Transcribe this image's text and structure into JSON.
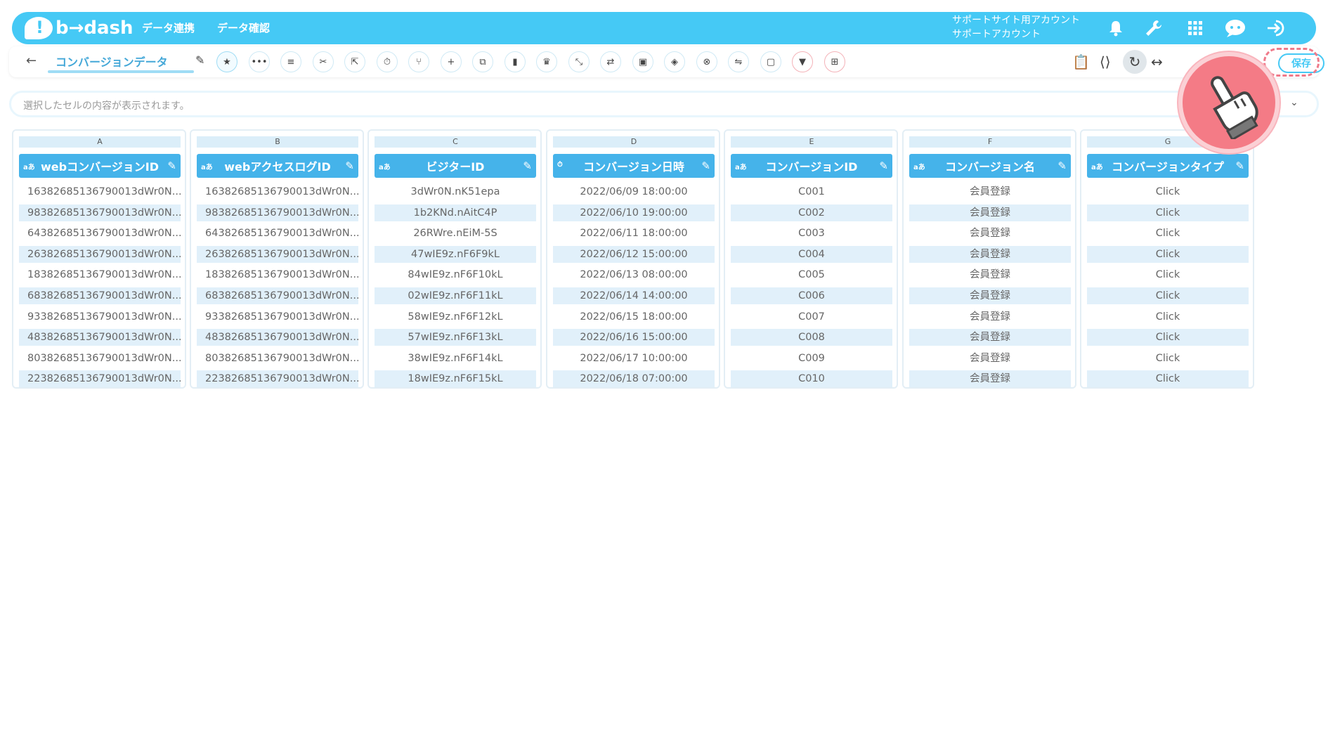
{
  "header": {
    "logo_text": "b→dash",
    "nav": [
      "データ連携",
      "データ確認"
    ],
    "account_line1": "サポートサイト用アカウント",
    "account_line2": "サポートアカウント",
    "icons": [
      "bell-icon",
      "wrench-icon",
      "apps-grid-icon",
      "chat-icon",
      "logout-icon"
    ]
  },
  "toolbar": {
    "back_icon": "←",
    "sheet_name": "コンバージョンデータ",
    "tool_icons": [
      "star-icon",
      "more-icon",
      "list-icon",
      "cut-icon",
      "expand-icon",
      "timer-icon",
      "merge-icon",
      "plus-icon",
      "copy-icon",
      "trash-icon",
      "crown-icon",
      "shrink-icon",
      "repeat-icon",
      "lock-icon",
      "stack-icon",
      "cancel-icon",
      "translate-icon",
      "frame-icon",
      "filter-icon",
      "grid-icon"
    ],
    "right_icons": [
      "clipboard-icon",
      "share-icon",
      "refresh-icon",
      "code-icon"
    ],
    "save_label": "保存"
  },
  "cellbar": {
    "placeholder": "選択したセルの内容が表示されます。"
  },
  "columns": [
    {
      "letter": "A",
      "type": "aあ",
      "header": "webコンバージョンID",
      "truncated": true,
      "rows": [
        "16382685136790013dWr0N...",
        "98382685136790013dWr0N...",
        "64382685136790013dWr0N...",
        "26382685136790013dWr0N...",
        "18382685136790013dWr0N...",
        "68382685136790013dWr0N...",
        "93382685136790013dWr0N...",
        "48382685136790013dWr0N...",
        "80382685136790013dWr0N...",
        "22382685136790013dWr0N..."
      ]
    },
    {
      "letter": "B",
      "type": "aあ",
      "header": "webアクセスログID",
      "truncated": true,
      "rows": [
        "16382685136790013dWr0N...",
        "98382685136790013dWr0N...",
        "64382685136790013dWr0N...",
        "26382685136790013dWr0N...",
        "18382685136790013dWr0N...",
        "68382685136790013dWr0N...",
        "93382685136790013dWr0N...",
        "48382685136790013dWr0N...",
        "80382685136790013dWr0N...",
        "22382685136790013dWr0N..."
      ]
    },
    {
      "letter": "C",
      "type": "aあ",
      "header": "ビジターID",
      "truncated": false,
      "rows": [
        "3dWr0N.nK51epa",
        "1b2KNd.nAitC4P",
        "26RWre.nEiM-5S",
        "47wIE9z.nF6F9kL",
        "84wIE9z.nF6F10kL",
        "02wIE9z.nF6F11kL",
        "58wIE9z.nF6F12kL",
        "57wIE9z.nF6F13kL",
        "38wIE9z.nF6F14kL",
        "18wIE9z.nF6F15kL"
      ]
    },
    {
      "letter": "D",
      "type": "⏱",
      "header": "コンバージョン日時",
      "truncated": false,
      "rows": [
        "2022/06/09 18:00:00",
        "2022/06/10 19:00:00",
        "2022/06/11 18:00:00",
        "2022/06/12 15:00:00",
        "2022/06/13 08:00:00",
        "2022/06/14 14:00:00",
        "2022/06/15 18:00:00",
        "2022/06/16 15:00:00",
        "2022/06/17 10:00:00",
        "2022/06/18 07:00:00"
      ]
    },
    {
      "letter": "E",
      "type": "aあ",
      "header": "コンバージョンID",
      "truncated": false,
      "rows": [
        "C001",
        "C002",
        "C003",
        "C004",
        "C005",
        "C006",
        "C007",
        "C008",
        "C009",
        "C010"
      ]
    },
    {
      "letter": "F",
      "type": "aあ",
      "header": "コンバージョン名",
      "truncated": false,
      "rows": [
        "会員登録",
        "会員登録",
        "会員登録",
        "会員登録",
        "会員登録",
        "会員登録",
        "会員登録",
        "会員登録",
        "会員登録",
        "会員登録"
      ]
    },
    {
      "letter": "G",
      "type": "aあ",
      "header": "コンバージョンタイプ",
      "truncated": false,
      "rows": [
        "Click",
        "Click",
        "Click",
        "Click",
        "Click",
        "Click",
        "Click",
        "Click",
        "Click",
        "Click"
      ]
    }
  ],
  "colors": {
    "brand": "#45c9f5",
    "column_header": "#45b3ea",
    "pointer": "#f47b86"
  }
}
